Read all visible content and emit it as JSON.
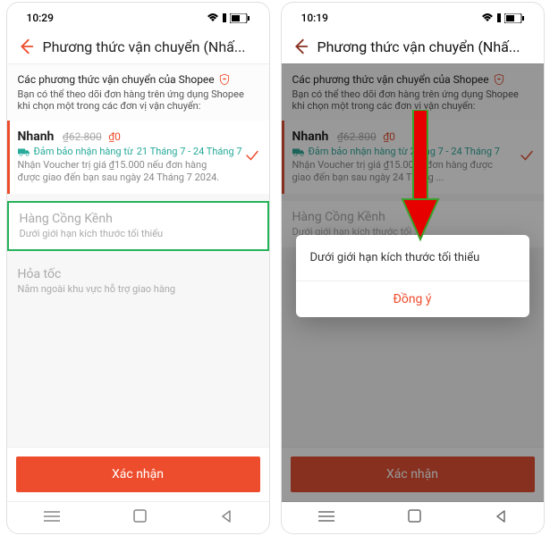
{
  "screen1": {
    "time": "10:29",
    "title": "Phương thức vận chuyển (Nhấ...",
    "info_title": "Các phương thức vận chuyển của Shopee",
    "info_sub": "Bạn có thể theo dõi đơn hàng trên ứng dụng Shopee khi chọn một trong các đơn vị vận chuyển:",
    "nhanh": {
      "name": "Nhanh",
      "old_price": "₫62.800",
      "new_price": "₫0",
      "guarantee_prefix": "Đảm bảo nhận hàng từ",
      "guarantee_dates": "21 Tháng 7 - 24 Tháng 7",
      "voucher": "Nhận Voucher trị giá ₫15.000 nếu đơn hàng được giao đến bạn sau ngày 24 Tháng 7 2024."
    },
    "congkenh": {
      "name": "Hàng Cồng Kềnh",
      "sub": "Dưới giới hạn kích thước tối thiểu"
    },
    "hoatoc": {
      "name": "Hỏa tốc",
      "sub": "Nằm ngoài khu vực hỗ trợ giao hàng"
    },
    "confirm": "Xác nhận"
  },
  "screen2": {
    "time": "10:19",
    "title": "Phương thức vận chuyển (Nhấ...",
    "info_title": "Các phương thức vận chuyển của Shopee",
    "info_sub": "Bạn có thể theo dõi đơn hàng trên ứng dụng Shopee khi chọn một trong các đơn vị vận chuyển:",
    "nhanh": {
      "name": "Nhanh",
      "old_price": "₫62.800",
      "new_price": "₫0",
      "guarantee_prefix": "Đảm bảo nhận hàng từ 2",
      "guarantee_suffix": "áng 7 - 24 Tháng 7",
      "voucher": "Nhận Voucher trị giá ₫15.00 ... đơn hàng được giao đến bạn sau ngày 24 Tháng ..."
    },
    "congkenh": {
      "name": "Hàng Cồng Kềnh",
      "sub": "Dưới giới hạn kích thước tối ..."
    },
    "modal_text": "Dưới giới hạn kích thước tối thiểu",
    "modal_ok": "Đồng ý",
    "confirm": "Xác nhận"
  }
}
